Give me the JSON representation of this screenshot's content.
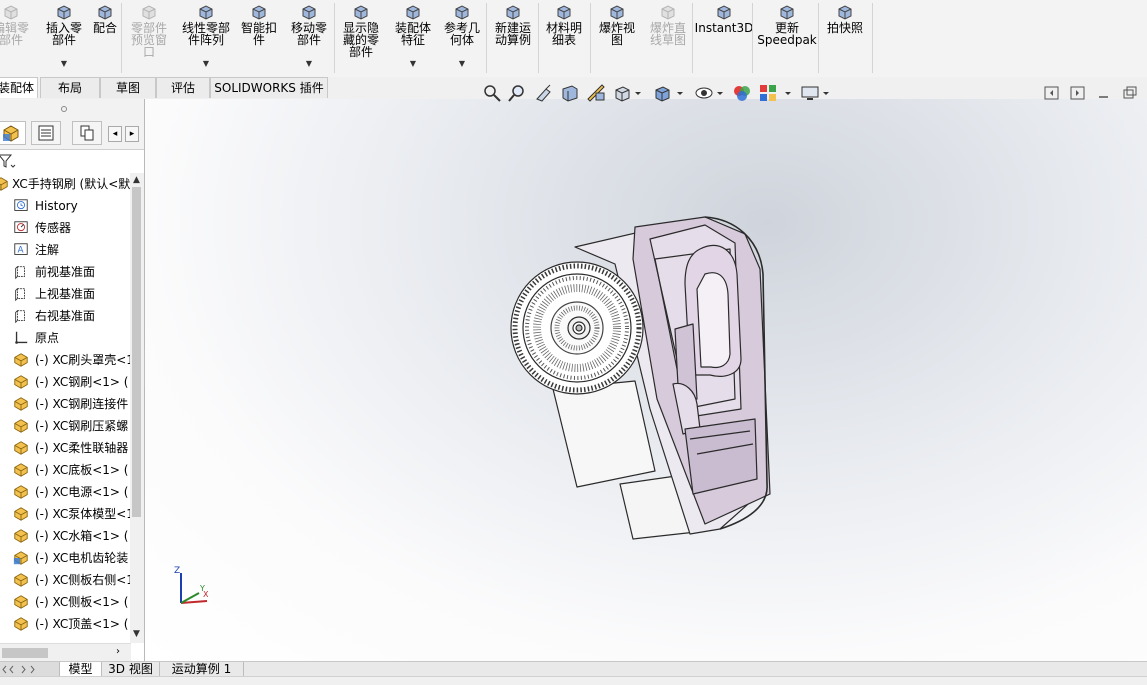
{
  "ribbon": {
    "buttons": [
      {
        "id": "edit-part",
        "label": "编辑零\n部件",
        "disabled": true,
        "dropdown": false
      },
      {
        "id": "insert-part",
        "label": "插入零\n部件",
        "disabled": false,
        "dropdown": true
      },
      {
        "id": "mate",
        "label": "配合",
        "disabled": false,
        "dropdown": false
      },
      {
        "id": "part-preview",
        "label": "零部件\n预览窗\n口",
        "disabled": true,
        "dropdown": false
      },
      {
        "id": "linear-pattern",
        "label": "线性零部\n件阵列",
        "disabled": false,
        "dropdown": true
      },
      {
        "id": "smart-fastener",
        "label": "智能扣\n件",
        "disabled": false,
        "dropdown": false
      },
      {
        "id": "move-part",
        "label": "移动零\n部件",
        "disabled": false,
        "dropdown": true
      },
      {
        "id": "show-hidden",
        "label": "显示隐\n藏的零\n部件",
        "disabled": false,
        "dropdown": false
      },
      {
        "id": "assembly-feature",
        "label": "装配体\n特征",
        "disabled": false,
        "dropdown": true
      },
      {
        "id": "reference-geometry",
        "label": "参考几\n何体",
        "disabled": false,
        "dropdown": true
      },
      {
        "id": "new-motion-study",
        "label": "新建运\n动算例",
        "disabled": false,
        "dropdown": false
      },
      {
        "id": "bom",
        "label": "材料明\n细表",
        "disabled": false,
        "dropdown": false
      },
      {
        "id": "exploded-view",
        "label": "爆炸视\n图",
        "disabled": false,
        "dropdown": false
      },
      {
        "id": "explode-line",
        "label": "爆炸直\n线草图",
        "disabled": true,
        "dropdown": false
      },
      {
        "id": "instant3d",
        "label": "Instant3D",
        "disabled": false,
        "dropdown": false
      },
      {
        "id": "update-speedpak",
        "label": "更新\nSpeedpak",
        "disabled": false,
        "dropdown": false
      },
      {
        "id": "snapshot",
        "label": "拍快照",
        "disabled": false,
        "dropdown": false
      }
    ]
  },
  "tabs": [
    "装配体",
    "布局",
    "草图",
    "评估",
    "SOLIDWORKS 插件"
  ],
  "tree": {
    "root": "XC手持钢刷 (默认<默",
    "items": [
      {
        "label": "History",
        "icon": "history-icon"
      },
      {
        "label": "传感器",
        "icon": "sensor-icon"
      },
      {
        "label": "注解",
        "icon": "annotation-icon"
      },
      {
        "label": "前视基准面",
        "icon": "plane-icon"
      },
      {
        "label": "上视基准面",
        "icon": "plane-icon"
      },
      {
        "label": "右视基准面",
        "icon": "plane-icon"
      },
      {
        "label": "原点",
        "icon": "origin-icon"
      },
      {
        "label": "(-) XC刷头罩壳<1",
        "icon": "part-icon"
      },
      {
        "label": "(-) XC钢刷<1> (",
        "icon": "part-icon"
      },
      {
        "label": "(-) XC钢刷连接件",
        "icon": "part-icon"
      },
      {
        "label": "(-) XC钢刷压紧螺",
        "icon": "part-icon"
      },
      {
        "label": "(-) XC柔性联轴器",
        "icon": "part-icon"
      },
      {
        "label": "(-) XC底板<1> (",
        "icon": "part-icon"
      },
      {
        "label": "(-) XC电源<1> (",
        "icon": "part-icon"
      },
      {
        "label": "(-) XC泵体模型<1",
        "icon": "part-icon"
      },
      {
        "label": "(-) XC水箱<1> (",
        "icon": "part-icon"
      },
      {
        "label": "(-) XC电机齿轮装",
        "icon": "subassembly-icon"
      },
      {
        "label": "(-) XC侧板右侧<1",
        "icon": "part-icon"
      },
      {
        "label": "(-) XC侧板<1> (",
        "icon": "part-icon"
      },
      {
        "label": "(-) XC顶盖<1> (",
        "icon": "part-icon"
      }
    ]
  },
  "bottom_tabs": [
    "模型",
    "3D 视图",
    "运动算例 1"
  ],
  "triad": {
    "x": "X",
    "y": "Y",
    "z": "Z"
  },
  "colors": {
    "accent": "#1a6fd6",
    "part": "#f2c14e",
    "model_body": "#d6cadb",
    "model_edge": "#2b2b2b"
  }
}
